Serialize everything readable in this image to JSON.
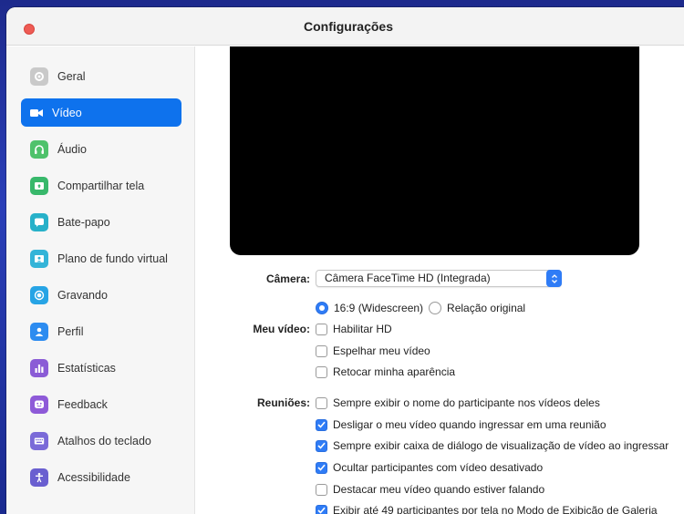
{
  "window": {
    "title": "Configurações"
  },
  "sidebar": {
    "items": [
      {
        "label": "Geral",
        "icon": "gear-icon",
        "color": "#c9c9c9",
        "active": false
      },
      {
        "label": "Vídeo",
        "icon": "video-camera-icon",
        "color": "#0e72ed",
        "active": true
      },
      {
        "label": "Áudio",
        "icon": "headphones-icon",
        "color": "#4fc26b",
        "active": false
      },
      {
        "label": "Compartilhar tela",
        "icon": "share-screen-icon",
        "color": "#38b86b",
        "active": false
      },
      {
        "label": "Bate-papo",
        "icon": "chat-bubble-icon",
        "color": "#27b1c9",
        "active": false
      },
      {
        "label": "Plano de fundo virtual",
        "icon": "virtual-background-icon",
        "color": "#34b4d8",
        "active": false
      },
      {
        "label": "Gravando",
        "icon": "record-icon",
        "color": "#27a4e5",
        "active": false
      },
      {
        "label": "Perfil",
        "icon": "person-icon",
        "color": "#2d8cf0",
        "active": false
      },
      {
        "label": "Estatísticas",
        "icon": "bar-chart-icon",
        "color": "#8b5cd6",
        "active": false
      },
      {
        "label": "Feedback",
        "icon": "smiley-icon",
        "color": "#8e5ad8",
        "active": false
      },
      {
        "label": "Atalhos do teclado",
        "icon": "keyboard-icon",
        "color": "#7a6ad8",
        "active": false
      },
      {
        "label": "Acessibilidade",
        "icon": "accessibility-icon",
        "color": "#6a5fd0",
        "active": false
      }
    ]
  },
  "main": {
    "camera_label": "Câmera:",
    "camera_value": "Câmera FaceTime HD (Integrada)",
    "video_label": "Meu vídeo:",
    "ratio_options": [
      {
        "label": "16:9 (Widescreen)",
        "selected": true
      },
      {
        "label": "Relação original",
        "selected": false
      }
    ],
    "video_options": [
      {
        "label": "Habilitar HD",
        "checked": false
      },
      {
        "label": "Espelhar meu vídeo",
        "checked": false
      },
      {
        "label": "Retocar minha aparência",
        "checked": false
      }
    ],
    "meetings_label": "Reuniões:",
    "meeting_options": [
      {
        "label": "Sempre exibir o nome do participante nos vídeos deles",
        "checked": false
      },
      {
        "label": "Desligar o meu vídeo quando ingressar em uma reunião",
        "checked": true
      },
      {
        "label": "Sempre exibir caixa de diálogo de visualização de vídeo ao ingressar",
        "checked": true
      },
      {
        "label": "Ocultar participantes com vídeo desativado",
        "checked": true
      },
      {
        "label": "Destacar meu vídeo quando estiver falando",
        "checked": false
      },
      {
        "label": "Exibir até 49 participantes por tela no Modo de Exibição de Galeria",
        "checked": true
      }
    ]
  }
}
